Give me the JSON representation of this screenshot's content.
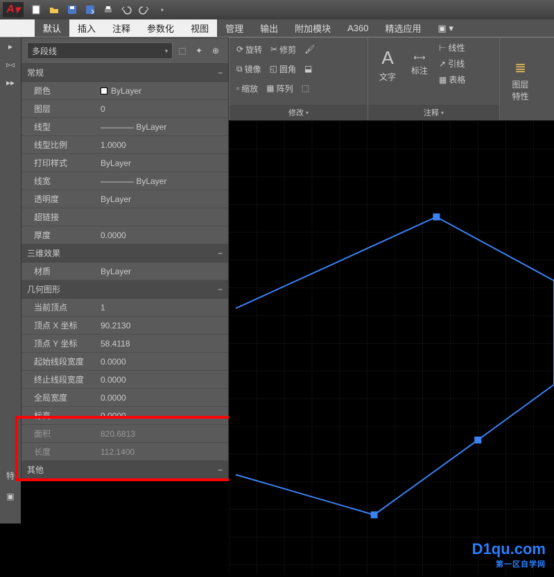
{
  "app_letter": "A",
  "menu_tabs": [
    "默认",
    "插入",
    "注释",
    "参数化",
    "视图",
    "管理",
    "输出",
    "附加模块",
    "A360",
    "精选应用"
  ],
  "active_tab": 0,
  "object_type": "多段线",
  "ribbon": {
    "modify": {
      "row1": [
        "旋转",
        "修剪"
      ],
      "row2": [
        "镜像",
        "圆角"
      ],
      "row3": [
        "缩放",
        "阵列"
      ],
      "label": "修改"
    },
    "annotate": {
      "text": "文字",
      "dim": "标注",
      "col": [
        "线性",
        "引线",
        "表格"
      ],
      "label": "注释"
    },
    "layer": {
      "label": "图层\n特性"
    }
  },
  "sections": {
    "general": {
      "title": "常规",
      "rows": [
        {
          "k": "颜色",
          "v": "ByLayer",
          "swatch": true
        },
        {
          "k": "图层",
          "v": "0"
        },
        {
          "k": "线型",
          "v": "———— ByLayer"
        },
        {
          "k": "线型比例",
          "v": "1.0000"
        },
        {
          "k": "打印样式",
          "v": "ByLayer"
        },
        {
          "k": "线宽",
          "v": "———— ByLayer"
        },
        {
          "k": "透明度",
          "v": "ByLayer"
        },
        {
          "k": "超链接",
          "v": ""
        },
        {
          "k": "厚度",
          "v": "0.0000"
        }
      ]
    },
    "threed": {
      "title": "三维效果",
      "rows": [
        {
          "k": "材质",
          "v": "ByLayer"
        }
      ]
    },
    "geom": {
      "title": "几何图形",
      "rows": [
        {
          "k": "当前顶点",
          "v": "1"
        },
        {
          "k": "顶点 X 坐标",
          "v": "90.2130"
        },
        {
          "k": "顶点 Y 坐标",
          "v": "58.4118"
        },
        {
          "k": "起始线段宽度",
          "v": "0.0000"
        },
        {
          "k": "终止线段宽度",
          "v": "0.0000"
        },
        {
          "k": "全局宽度",
          "v": "0.0000"
        },
        {
          "k": "标高",
          "v": "0.0000"
        },
        {
          "k": "面积",
          "v": "820.6813",
          "faded": true
        },
        {
          "k": "长度",
          "v": "112.1400",
          "faded": true
        }
      ]
    },
    "other": {
      "title": "其他"
    }
  },
  "highlight_rows": [
    "标高",
    "面积",
    "长度"
  ],
  "watermark": {
    "main": "D1qu.com",
    "sub": "第一区自学网"
  }
}
